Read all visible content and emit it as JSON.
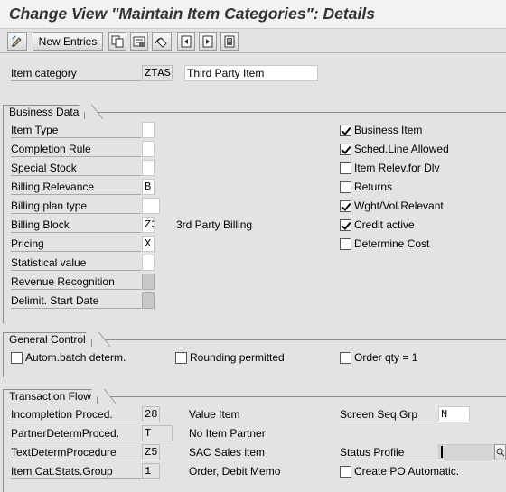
{
  "window": {
    "title": "Change View \"Maintain Item Categories\": Details"
  },
  "toolbar": {
    "new_entries_label": "New Entries",
    "icons": [
      "edit-icon",
      "copy-icon",
      "delete-icon",
      "undo-icon",
      "first-page-icon",
      "previous-page-icon",
      "next-page-icon"
    ]
  },
  "header": {
    "item_category_label": "Item category",
    "item_category_value": "ZTAS",
    "item_category_text": "Third Party Item"
  },
  "business_data": {
    "title": "Business Data",
    "fields": [
      {
        "label": "Item Type",
        "value": "",
        "desc": ""
      },
      {
        "label": "Completion Rule",
        "value": "",
        "desc": ""
      },
      {
        "label": "Special Stock",
        "value": "",
        "desc": ""
      },
      {
        "label": "Billing Relevance",
        "value": "B",
        "desc": ""
      },
      {
        "label": "Billing plan type",
        "value": "",
        "desc": ""
      },
      {
        "label": "Billing Block",
        "value": "Z3",
        "desc": "3rd Party Billing"
      },
      {
        "label": "Pricing",
        "value": "X",
        "desc": ""
      },
      {
        "label": "Statistical value",
        "value": "",
        "desc": ""
      },
      {
        "label": "Revenue Recognition",
        "value": "",
        "desc": ""
      },
      {
        "label": "Delimit. Start Date",
        "value": "",
        "desc": ""
      }
    ],
    "checkboxes": [
      {
        "label": "Business Item",
        "checked": true
      },
      {
        "label": "Sched.Line Allowed",
        "checked": true
      },
      {
        "label": "Item Relev.for Dlv",
        "checked": false
      },
      {
        "label": "Returns",
        "checked": false
      },
      {
        "label": "Wght/Vol.Relevant",
        "checked": true
      },
      {
        "label": "Credit active",
        "checked": true
      },
      {
        "label": "Determine Cost",
        "checked": false
      }
    ]
  },
  "general_control": {
    "title": "General Control",
    "checkboxes": [
      {
        "label": "Autom.batch determ.",
        "checked": false
      },
      {
        "label": "Rounding permitted",
        "checked": false
      },
      {
        "label": "Order qty = 1",
        "checked": false
      }
    ]
  },
  "transaction_flow": {
    "title": "Transaction Flow",
    "fields": [
      {
        "label": "Incompletion Proced.",
        "value": "28",
        "desc": "Value Item"
      },
      {
        "label": "PartnerDetermProced.",
        "value": "T",
        "desc": "No Item Partner"
      },
      {
        "label": "TextDetermProcedure",
        "value": "Z5",
        "desc": "SAC Sales item"
      },
      {
        "label": "Item Cat.Stats.Group",
        "value": "1",
        "desc": "Order, Debit Memo"
      }
    ],
    "screen_seq_label": "Screen Seq.Grp",
    "screen_seq_value": "N",
    "status_profile_label": "Status Profile",
    "status_profile_value": "",
    "create_po_label": "Create PO Automatic.",
    "create_po_checked": false
  }
}
